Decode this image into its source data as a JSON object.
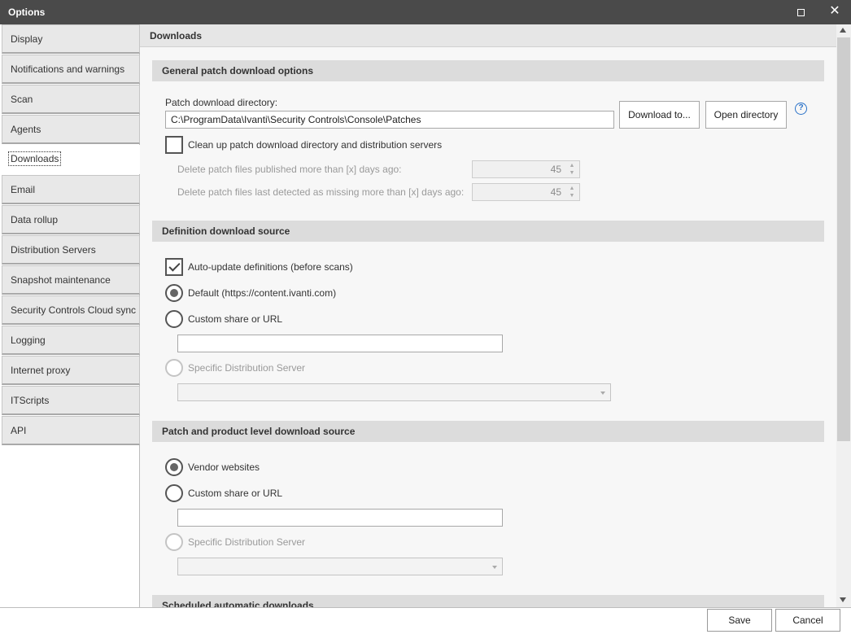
{
  "window": {
    "title": "Options"
  },
  "sidebar": {
    "items": [
      {
        "label": "Display"
      },
      {
        "label": "Notifications and warnings"
      },
      {
        "label": "Scan"
      },
      {
        "label": "Agents"
      },
      {
        "label": "Downloads",
        "selected": true
      },
      {
        "label": "Email"
      },
      {
        "label": "Data rollup"
      },
      {
        "label": "Distribution Servers"
      },
      {
        "label": "Snapshot maintenance"
      },
      {
        "label": "Security Controls Cloud sync"
      },
      {
        "label": "Logging"
      },
      {
        "label": "Internet proxy"
      },
      {
        "label": "ITScripts"
      },
      {
        "label": "API"
      }
    ]
  },
  "page": {
    "title": "Downloads"
  },
  "general": {
    "heading": "General patch download options",
    "dir_label": "Patch download directory:",
    "dir_value": "C:\\ProgramData\\Ivanti\\Security Controls\\Console\\Patches",
    "download_to_label": "Download to...",
    "open_dir_label": "Open directory",
    "help_glyph": "?",
    "cleanup_label": "Clean up patch download directory and distribution servers",
    "cleanup_checked": false,
    "published_label": "Delete patch files published more than [x] days ago:",
    "published_value": "45",
    "missing_label": "Delete patch files last detected as missing more than [x] days ago:",
    "missing_value": "45"
  },
  "definition": {
    "heading": "Definition download source",
    "auto_update_label": "Auto-update definitions (before scans)",
    "auto_update_checked": true,
    "default_label": "Default (https://content.ivanti.com)",
    "custom_label": "Custom share or URL",
    "custom_value": "",
    "specific_label": "Specific Distribution Server",
    "selected": "default"
  },
  "patch_source": {
    "heading": "Patch and product level download source",
    "vendor_label": "Vendor websites",
    "custom_label": "Custom share or URL",
    "custom_value": "",
    "specific_label": "Specific Distribution Server",
    "selected": "vendor"
  },
  "scheduled": {
    "heading": "Scheduled automatic downloads"
  },
  "footer": {
    "save_label": "Save",
    "cancel_label": "Cancel"
  },
  "icons": {
    "close": "close-icon",
    "maximize": "maximize-icon",
    "help": "help-icon"
  },
  "colors": {
    "titlebar": "#4a4a4a",
    "section_header": "#dcdcdc",
    "help_accent": "#2a72c8"
  }
}
